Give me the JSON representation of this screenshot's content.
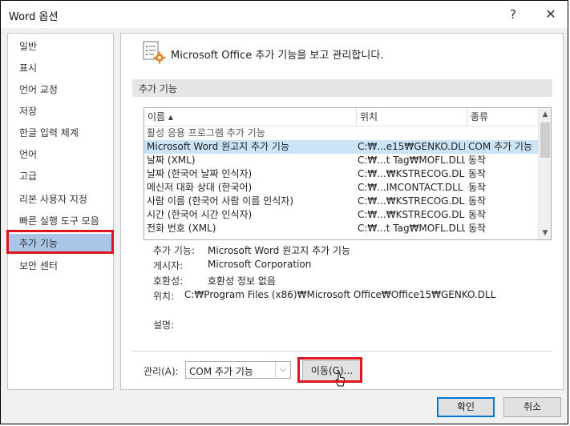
{
  "window": {
    "title": "Word 옵션",
    "help_label": "?",
    "close_label": "✕"
  },
  "sidebar": {
    "items": [
      {
        "label": "일반"
      },
      {
        "label": "표시"
      },
      {
        "label": "언어 교정"
      },
      {
        "label": "저장"
      },
      {
        "label": "한글 입력 체계"
      },
      {
        "label": "언어"
      },
      {
        "label": "고급"
      },
      {
        "label": "리본 사용자 지정"
      },
      {
        "label": "빠른 실행 도구 모음"
      },
      {
        "label": "추가 기능",
        "selected": true
      },
      {
        "label": "보안 센터"
      }
    ]
  },
  "main": {
    "header_text": "Microsoft Office 추가 기능을 보고 관리합니다.",
    "section_title": "추가 기능",
    "list": {
      "columns": [
        "이름 ▴",
        "위치",
        "종류"
      ],
      "group_label": "활성 응용 프로그램 추가 기능",
      "rows": [
        {
          "name": "Microsoft Word 원고지 추가 기능",
          "location": "C:₩...e15₩GENKO.DLL",
          "type": "COM 추가 기능",
          "selected": true
        },
        {
          "name": "날짜 (XML)",
          "location": "C:₩...t Tag₩MOFL.DLL",
          "type": "동작"
        },
        {
          "name": "날짜 (한국어 날짜 인식자)",
          "location": "C:₩...₩KSTRECOG.DLL",
          "type": "동작"
        },
        {
          "name": "메신저 대화 상대 (한국어)",
          "location": "C:₩...IMCONTACT.DLL",
          "type": "동작"
        },
        {
          "name": "사람 이름 (한국어 사람 이름 인식자)",
          "location": "C:₩...₩KSTRECOG.DLL",
          "type": "동작"
        },
        {
          "name": "시간 (한국어 시간 인식자)",
          "location": "C:₩...₩KSTRECOG.DLL",
          "type": "동작"
        },
        {
          "name": "전화 번호 (XML)",
          "location": "C:₩...t Tag₩MOFL.DLL",
          "type": "동작"
        }
      ]
    },
    "details": {
      "addin_label": "추가 기능:",
      "addin_value": "Microsoft Word 원고지 추가 기능",
      "publisher_label": "게시자:",
      "publisher_value": "Microsoft Corporation",
      "compat_label": "호환성:",
      "compat_value": "호환성 정보 없음",
      "location_label": "위치:",
      "location_value": "C:₩Program Files (x86)₩Microsoft Office₩Office15₩GENKO.DLL",
      "desc_label": "설명:"
    },
    "manage": {
      "label": "관리(A):",
      "selected": "COM 추가 기능",
      "go_label": "이동(G)..."
    }
  },
  "footer": {
    "ok_label": "확인",
    "cancel_label": "취소"
  },
  "colors": {
    "selection": "#aac5e6",
    "highlight_box": "#e0141e",
    "row_selection": "#cce4f7"
  }
}
